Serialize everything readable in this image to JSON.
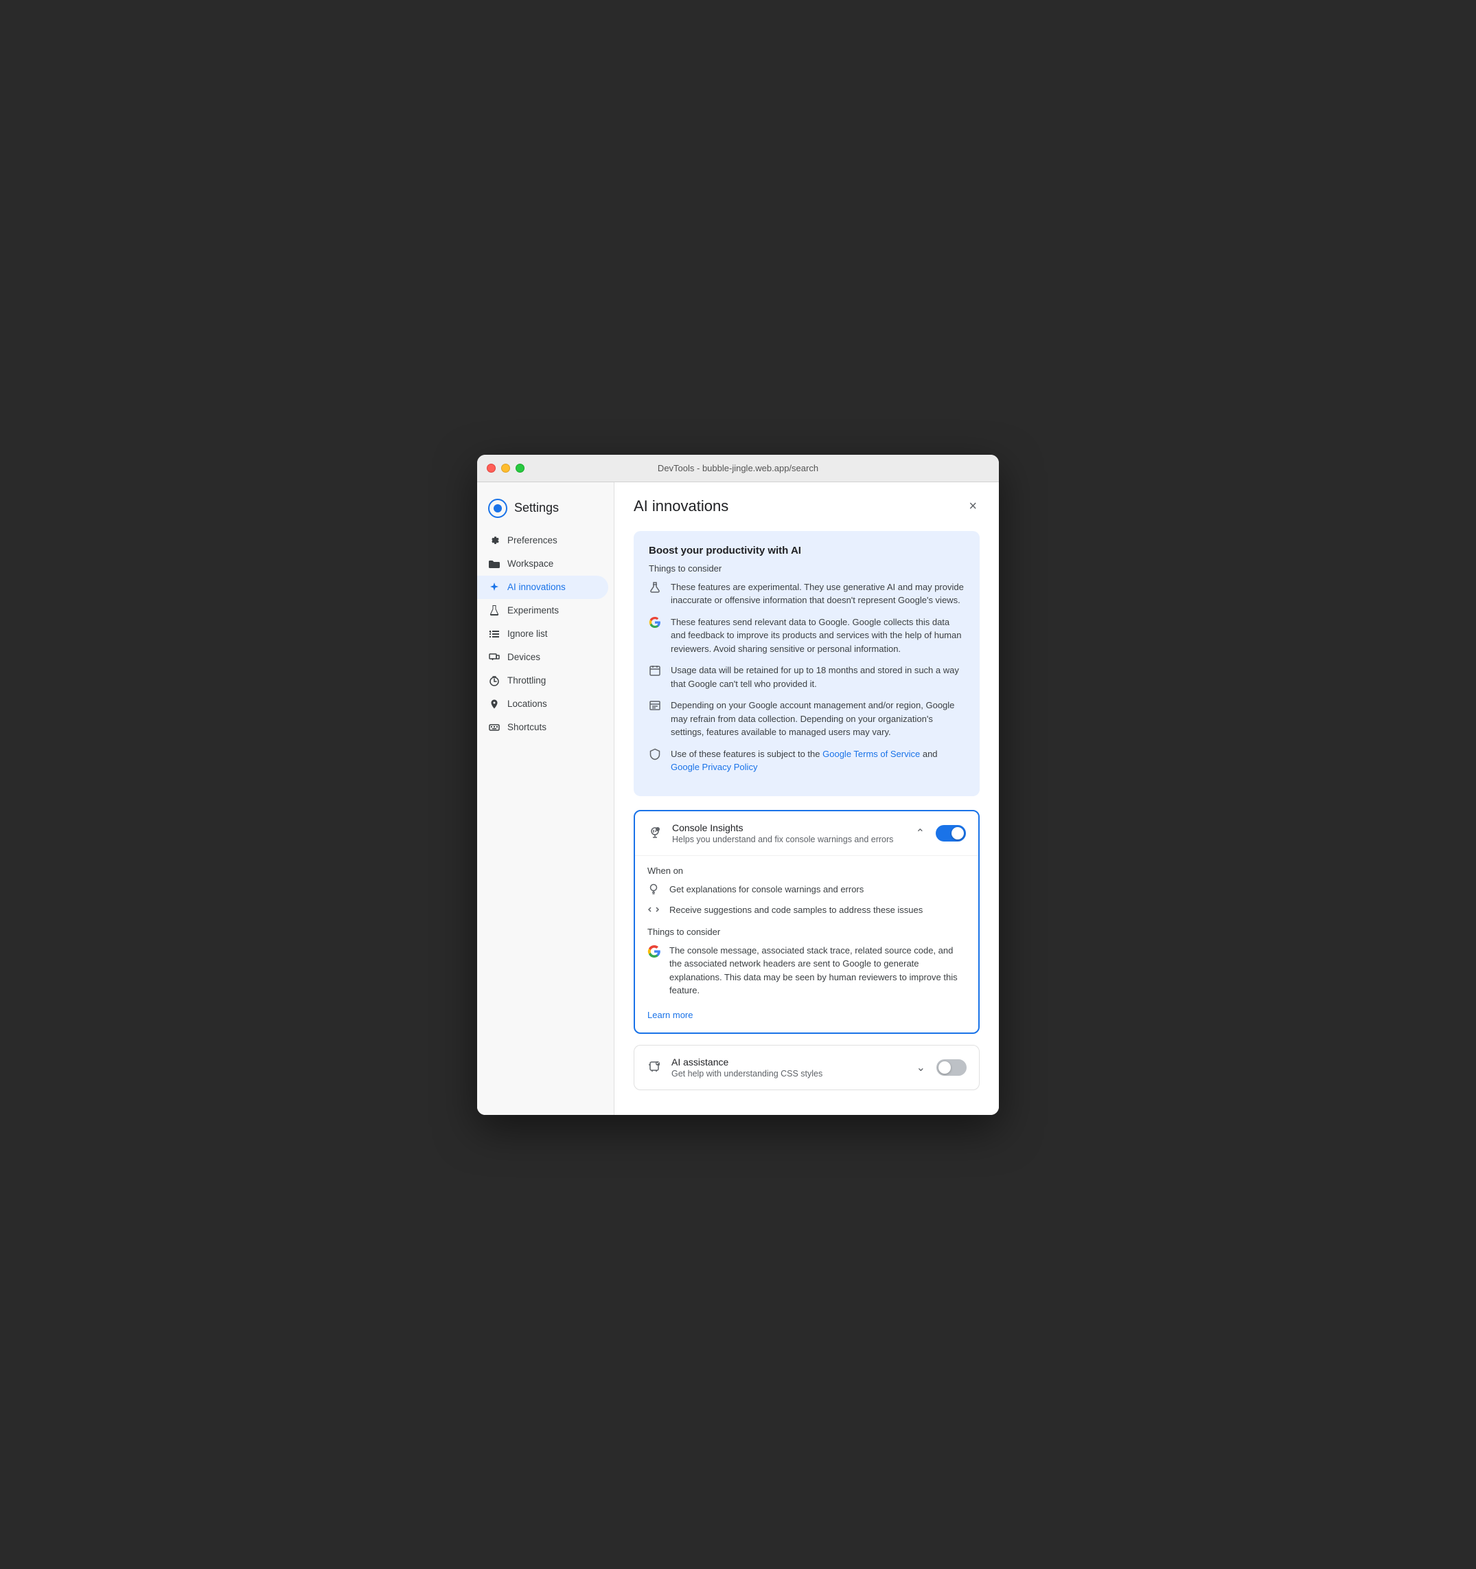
{
  "titlebar": {
    "title": "DevTools - bubble-jingle.web.app/search"
  },
  "sidebar": {
    "title": "Settings",
    "items": [
      {
        "id": "preferences",
        "label": "Preferences",
        "icon": "gear"
      },
      {
        "id": "workspace",
        "label": "Workspace",
        "icon": "folder"
      },
      {
        "id": "ai-innovations",
        "label": "AI innovations",
        "icon": "sparkle",
        "active": true
      },
      {
        "id": "experiments",
        "label": "Experiments",
        "icon": "flask"
      },
      {
        "id": "ignore-list",
        "label": "Ignore list",
        "icon": "list"
      },
      {
        "id": "devices",
        "label": "Devices",
        "icon": "devices"
      },
      {
        "id": "throttling",
        "label": "Throttling",
        "icon": "timer"
      },
      {
        "id": "locations",
        "label": "Locations",
        "icon": "pin"
      },
      {
        "id": "shortcuts",
        "label": "Shortcuts",
        "icon": "keyboard"
      }
    ]
  },
  "main": {
    "title": "AI innovations",
    "close_label": "×",
    "info_card": {
      "title": "Boost your productivity with AI",
      "things_label": "Things to consider",
      "items": [
        "These features are experimental. They use generative AI and may provide inaccurate or offensive information that doesn't represent Google's views.",
        "These features send relevant data to Google. Google collects this data and feedback to improve its products and services with the help of human reviewers. Avoid sharing sensitive or personal information.",
        "Usage data will be retained for up to 18 months and stored in such a way that Google can't tell who provided it.",
        "Depending on your Google account management and/or region, Google may refrain from data collection. Depending on your organization's settings, features available to managed users may vary.",
        "Use of these features is subject to the Google Terms of Service and Google Privacy Policy"
      ],
      "links": {
        "terms": "Google Terms of Service",
        "privacy": "Google Privacy Policy"
      }
    },
    "features": [
      {
        "id": "console-insights",
        "name": "Console Insights",
        "description": "Helps you understand and fix console warnings and errors",
        "enabled": true,
        "expanded": true,
        "when_on_label": "When on",
        "when_on_items": [
          {
            "text": "Get explanations for console warnings and errors",
            "icon": "lightbulb"
          },
          {
            "text": "Receive suggestions and code samples to address these issues",
            "icon": "code"
          }
        ],
        "things_label": "Things to consider",
        "things_items": [
          "The console message, associated stack trace, related source code, and the associated network headers are sent to Google to generate explanations. This data may be seen by human reviewers to improve this feature."
        ],
        "learn_more_label": "Learn more",
        "learn_more_url": "#"
      },
      {
        "id": "ai-assistance",
        "name": "AI assistance",
        "description": "Get help with understanding CSS styles",
        "enabled": false,
        "expanded": false
      }
    ]
  }
}
